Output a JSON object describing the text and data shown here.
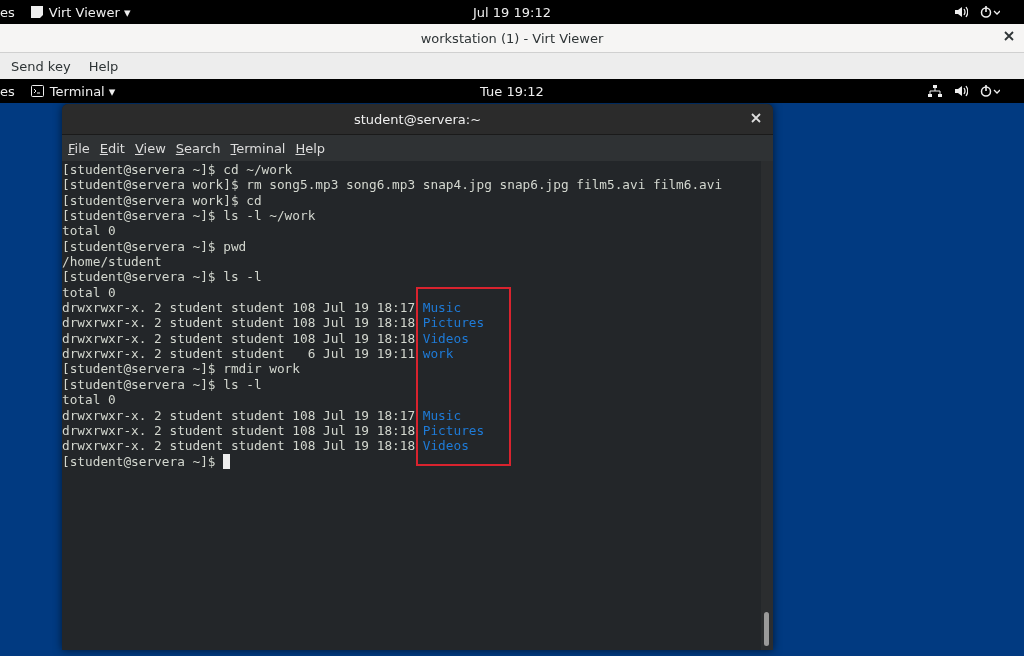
{
  "host_top_bar": {
    "activities": "es",
    "app_menu": "Virt Viewer ▾",
    "clock": "Jul 19  19:12"
  },
  "viewer_window": {
    "title": "workstation (1) - Virt Viewer",
    "menu": [
      "Send key",
      "Help"
    ]
  },
  "guest_top_bar": {
    "activities": "es",
    "app_menu": "Terminal ▾",
    "clock": "Tue 19:12"
  },
  "terminal": {
    "title": "student@servera:~",
    "menu": [
      "File",
      "Edit",
      "View",
      "Search",
      "Terminal",
      "Help"
    ],
    "lines": [
      {
        "text": "[student@servera ~]$ cd ~/work",
        "cursor": false
      },
      {
        "text": "[student@servera work]$ rm song5.mp3 song6.mp3 snap4.jpg snap6.jpg film5.avi film6.avi",
        "cursor": false
      },
      {
        "text": "[student@servera work]$ cd",
        "cursor": false
      },
      {
        "text": "[student@servera ~]$ ls -l ~/work",
        "cursor": false
      },
      {
        "text": "total 0",
        "cursor": false
      },
      {
        "text": "[student@servera ~]$ pwd",
        "cursor": false
      },
      {
        "text": "/home/student",
        "cursor": false
      },
      {
        "text": "[student@servera ~]$ ls -l",
        "cursor": false
      },
      {
        "text": "total 0",
        "cursor": false
      },
      {
        "text": "drwxrwxr-x. 2 student student 108 Jul 19 18:17",
        "dir": "Music",
        "cursor": false
      },
      {
        "text": "drwxrwxr-x. 2 student student 108 Jul 19 18:18",
        "dir": "Pictures",
        "cursor": false
      },
      {
        "text": "drwxrwxr-x. 2 student student 108 Jul 19 18:18",
        "dir": "Videos",
        "cursor": false
      },
      {
        "text": "drwxrwxr-x. 2 student student   6 Jul 19 19:11",
        "dir": "work",
        "cursor": false
      },
      {
        "text": "[student@servera ~]$ rmdir work",
        "cursor": false
      },
      {
        "text": "[student@servera ~]$ ls -l",
        "cursor": false
      },
      {
        "text": "total 0",
        "cursor": false
      },
      {
        "text": "drwxrwxr-x. 2 student student 108 Jul 19 18:17",
        "dir": "Music",
        "cursor": false
      },
      {
        "text": "drwxrwxr-x. 2 student student 108 Jul 19 18:18",
        "dir": "Pictures",
        "cursor": false
      },
      {
        "text": "drwxrwxr-x. 2 student student 108 Jul 19 18:18",
        "dir": "Videos",
        "cursor": false
      },
      {
        "text": "[student@servera ~]$",
        "cursor": true
      }
    ]
  }
}
